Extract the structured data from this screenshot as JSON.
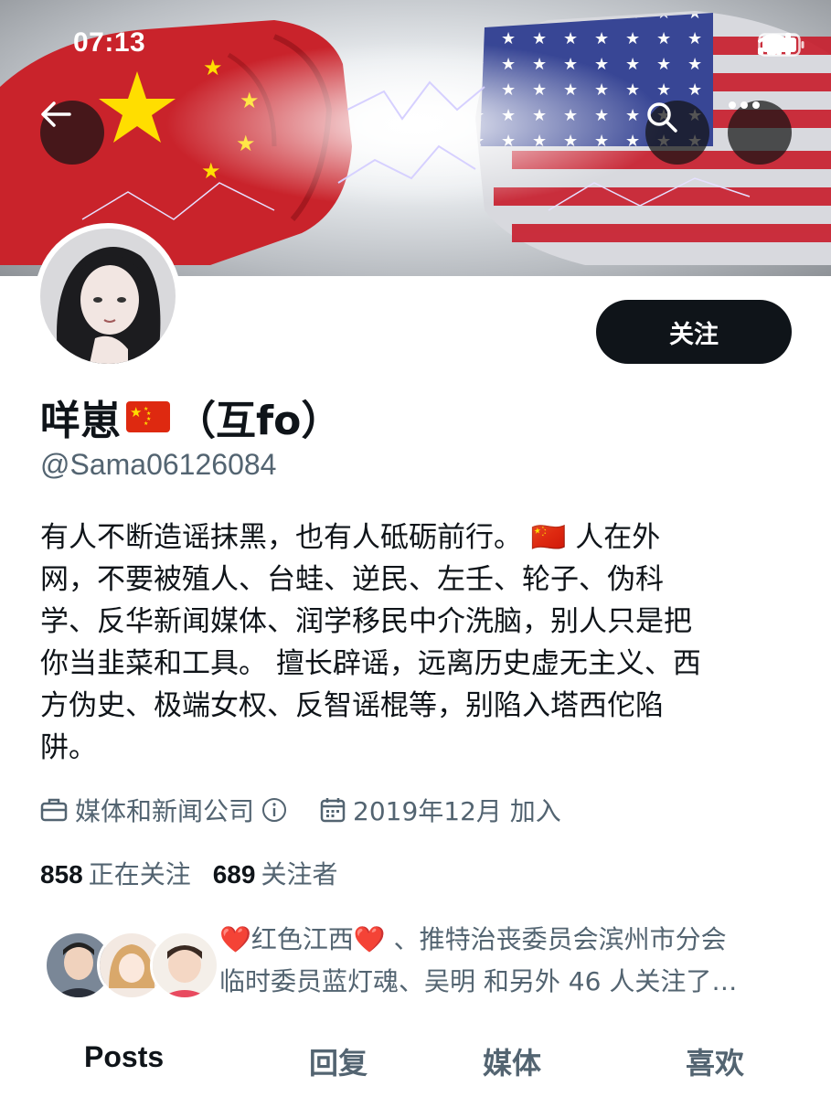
{
  "status_bar": {
    "time": "07:13"
  },
  "banner": {
    "image": "china-vs-usa-flag-fists",
    "icons": [
      "back-arrow-icon",
      "search-icon",
      "more-icon"
    ]
  },
  "profile": {
    "display_name": "咩崽",
    "display_name_suffix": "（互fo）",
    "handle": "@Sama06126084",
    "follow_label": "关注",
    "bio_lines": [
      "有人不断造谣抹黑，也有人砥砺前行。 🇨🇳 人在外",
      "网，不要被殖人、台蛙、逆民、左壬、轮子、伪科",
      "学、反华新闻媒体、润学移民中介洗脑，别人只是把",
      "你当韭菜和工具。 擅长辟谣，远离历史虚无主义、西",
      "方伪史、极端女权、反智谣棍等，别陷入塔西佗陷",
      "阱。"
    ],
    "category": "媒体和新闻公司",
    "joined": "2019年12月 加入",
    "following_count": "858",
    "following_label": "正在关注",
    "followers_count": "689",
    "followers_label": "关注者",
    "known_followers_line1": "❤️红色江西❤️ 、推特治丧委员会滨州市分会",
    "known_followers_line2": "临时委员蓝灯魂、吴明 和另外 46 人关注了…"
  },
  "tabs": [
    {
      "label": "Posts",
      "active": true
    },
    {
      "label": "回复",
      "active": false
    },
    {
      "label": "媒体",
      "active": false
    },
    {
      "label": "喜欢",
      "active": false
    }
  ],
  "colors": {
    "text_primary": "#0f1419",
    "text_secondary": "#536471",
    "button_bg": "#0f1419",
    "flag_red": "#de2910",
    "flag_yellow": "#ffde00"
  }
}
